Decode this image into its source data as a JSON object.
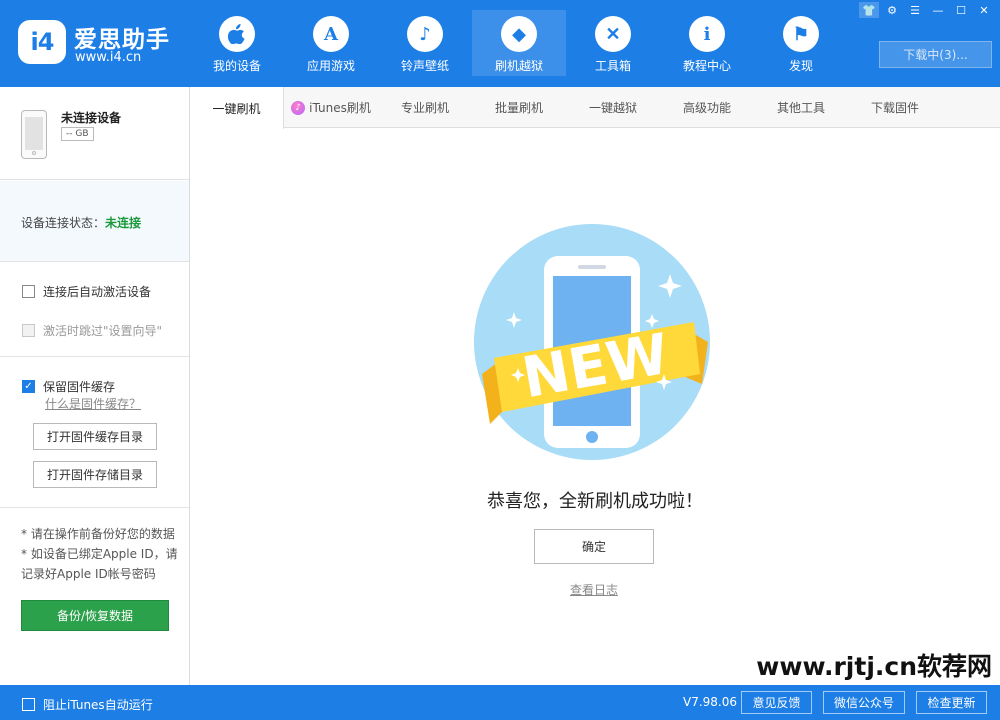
{
  "brand": {
    "badge": "i4",
    "name": "爱思助手",
    "url": "www.i4.cn"
  },
  "nav": [
    {
      "label": "我的设备",
      "icon": "apple-icon",
      "glyph": ""
    },
    {
      "label": "应用游戏",
      "icon": "app-store-icon",
      "glyph": "A"
    },
    {
      "label": "铃声壁纸",
      "icon": "music-icon",
      "glyph": "♪"
    },
    {
      "label": "刷机越狱",
      "icon": "dropbox-icon",
      "glyph": "◆"
    },
    {
      "label": "工具箱",
      "icon": "tools-icon",
      "glyph": "✕"
    },
    {
      "label": "教程中心",
      "icon": "info-icon",
      "glyph": "i"
    },
    {
      "label": "发现",
      "icon": "flag-icon",
      "glyph": "⚑"
    }
  ],
  "window_controls": {
    "skin": "👕",
    "settings": "⚙",
    "menu": "☰",
    "minimize": "—",
    "maximize": "☐",
    "close": "✕"
  },
  "download_label": "下载中(3)...",
  "device": {
    "name": "未连接设备",
    "capacity": "-- GB",
    "status_label": "设备连接状态：",
    "status_value": "未连接"
  },
  "options": {
    "auto_activate": "连接后自动激活设备",
    "skip_setup": "激活时跳过\"设置向导\"",
    "keep_cache": "保留固件缓存",
    "what_is_cache": "什么是固件缓存？",
    "open_cache_dir": "打开固件缓存目录",
    "open_storage_dir": "打开固件存储目录"
  },
  "notes": {
    "line1": "* 请在操作前备份好您的数据",
    "line2": "* 如设备已绑定Apple ID，请记录好Apple ID帐号密码"
  },
  "backup_label": "备份/恢复数据",
  "tabs": [
    "一键刷机",
    "iTunes刷机",
    "专业刷机",
    "批量刷机",
    "一键越狱",
    "高级功能",
    "其他工具",
    "下载固件"
  ],
  "illustration": {
    "badge_text": "NEW"
  },
  "success_message": "恭喜您，全新刷机成功啦！",
  "confirm_label": "确定",
  "view_log_label": "查看日志",
  "watermark": "www.rjtj.cn软荐网",
  "footer": {
    "block_itunes": "阻止iTunes自动运行",
    "version": "V7.98.06",
    "feedback": "意见反馈",
    "wechat": "微信公众号",
    "check_update": "检查更新"
  },
  "colors": {
    "primary": "#1d7ee6",
    "success": "#2aa14a",
    "status_green": "#1a9a3a",
    "ribbon": "#ffd93a"
  }
}
